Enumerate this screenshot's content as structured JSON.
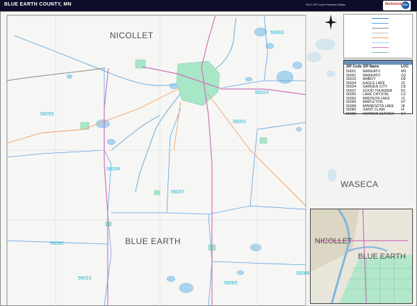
{
  "header": {
    "title": "BLUE EARTH COUNTY, MN",
    "edition": "2021 ZIP Code Premium Edition",
    "logo_text": "Marketmaps",
    "logo_badge": "USA"
  },
  "map": {
    "county_labels": [
      {
        "text": "NICOLLET"
      },
      {
        "text": "WASECA"
      },
      {
        "text": "BLUE EARTH"
      }
    ],
    "zip_labels": [
      "56063",
      "56024",
      "56055",
      "56001",
      "56034",
      "56037",
      "56090",
      "56010",
      "56065",
      "56068"
    ],
    "colors": {
      "background": "#f6f6f4",
      "water": "#a9d4ee",
      "city": "#a8e6c8",
      "zip_boundary": "#5aa0e6",
      "highway": "#d070b8",
      "county_road": "#f0a060",
      "title_bar": "#0d0d2b"
    }
  },
  "zip_table": {
    "headers": [
      "ZIP Code",
      "ZIP Name",
      "LOC"
    ],
    "rows": [
      [
        "56001",
        "MANKATO",
        "M9"
      ],
      [
        "56001",
        "MANKATO",
        "G3"
      ],
      [
        "56010",
        "AMBOY",
        "D8"
      ],
      [
        "56024",
        "EAGLE LAKE",
        "J3"
      ],
      [
        "56024",
        "GARDEN CITY",
        "C8"
      ],
      [
        "56037",
        "GOOD THUNDER",
        "F5"
      ],
      [
        "56055",
        "LAKE CRYSTAL",
        "C3"
      ],
      [
        "56063",
        "MADISON LAKE",
        "J2"
      ],
      [
        "56065",
        "MAPLETON",
        "H7"
      ],
      [
        "56068",
        "MINNESOTA LAKE",
        "J8"
      ],
      [
        "56080",
        "SAINT CLAIR",
        "I4"
      ],
      [
        "56090",
        "VERNON CENTER",
        "C7"
      ]
    ]
  },
  "inset": {
    "labels": [
      "NICOLLET",
      "BLUE EARTH"
    ]
  },
  "compass_icon": "compass-rose-icon"
}
